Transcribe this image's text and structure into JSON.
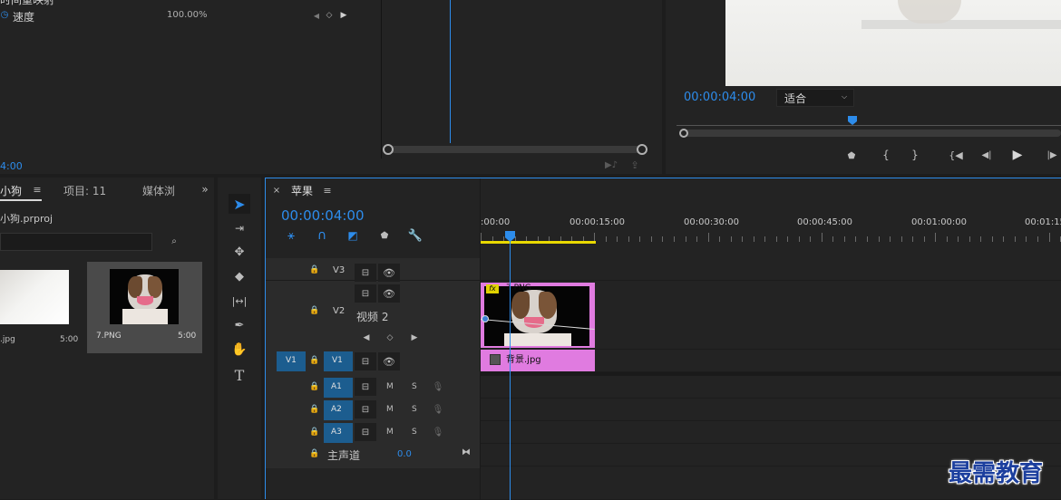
{
  "effect_controls": {
    "partial_label": "时间重映射",
    "speed_label": "速度",
    "speed_value": "100.00%",
    "timecode_partial": "4:00"
  },
  "program_monitor": {
    "timecode": "00:00:04:00",
    "fit_label": "适合"
  },
  "project_panel": {
    "tab_project_name": "小狗",
    "tab_project_items": "项目: 11",
    "tab_media_browser": "媒体浏",
    "file_name": "小狗.prproj",
    "items": [
      {
        "name": ".jpg",
        "duration": "5:00"
      },
      {
        "name": "7.PNG",
        "duration": "5:00"
      }
    ]
  },
  "timeline": {
    "sequence_name": "苹果",
    "timecode": "00:00:04:00",
    "ruler_labels": [
      ":00:00",
      "00:00:15:00",
      "00:00:30:00",
      "00:00:45:00",
      "00:01:00:00",
      "00:01:15"
    ],
    "tracks": {
      "v3": "V3",
      "v2": "V2",
      "v2_name": "视频 2",
      "v1": "V1",
      "v1_source": "V1",
      "a1": "A1",
      "a2": "A2",
      "a3": "A3",
      "mute": "M",
      "solo": "S",
      "master_label": "主声道",
      "master_value": "0.0"
    },
    "clips": {
      "png_clip": "7.PNG",
      "fx_badge": "fx",
      "bg_clip": "背景.jpg"
    }
  },
  "watermark": "最需教育",
  "colors": {
    "accent": "#2d8ceb",
    "clip_pink": "#e07be0",
    "track_blue": "#1c5d8f"
  }
}
